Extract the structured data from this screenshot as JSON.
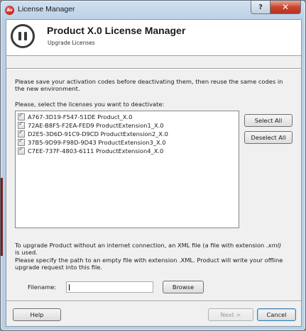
{
  "window": {
    "title": "License Manager",
    "app_icon_text": "Av"
  },
  "header": {
    "title": "Product X.0 License Manager",
    "subtitle": "Upgrade Licenses"
  },
  "intro": {
    "line1": "Please save your activation codes before deactivating them, then reuse the same codes in",
    "line2": "the new environment."
  },
  "select_prompt": "Please, select the licenses you want to deactivate:",
  "licenses": [
    {
      "code": "A767-3D19-F547-51DE",
      "name": "Product_X.0",
      "checked": true
    },
    {
      "code": "72AE-B8F5-F2EA-FED9",
      "name": "ProductExtension1_X.0",
      "checked": true
    },
    {
      "code": "D2E5-3D6D-91C9-D9CD",
      "name": "ProductExtension2_X.0",
      "checked": true
    },
    {
      "code": "37B5-9D99-F98D-9D43",
      "name": "ProductExtension3_X.0",
      "checked": true
    },
    {
      "code": "C7EE-737F-4803-6111",
      "name": "ProductExtension4_X.0",
      "checked": true
    }
  ],
  "buttons": {
    "select_all": "Select All",
    "deselect_all": "Deselect All",
    "browse": "Browse",
    "help": "Help",
    "next": "Next >",
    "cancel": "Cancel"
  },
  "offline": {
    "line1_pre": "To upgrade  Product without an internet connection, an XML file (a file with extension ",
    "line1_ext": ".xml)",
    "line2": "is used.",
    "line3": "Please specify the path to an empty file with extension .XML. Product will write your offline",
    "line4": "upgrade request into this file."
  },
  "filename": {
    "label": "Filename:",
    "value": ""
  }
}
